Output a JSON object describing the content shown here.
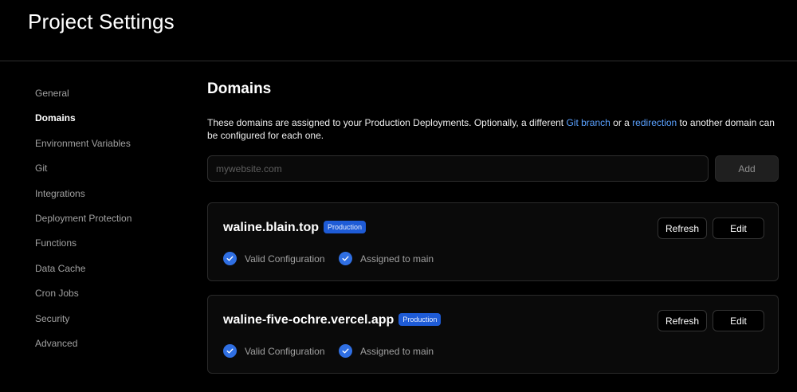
{
  "header": {
    "title": "Project Settings"
  },
  "sidebar": {
    "items": [
      {
        "label": "General",
        "active": false
      },
      {
        "label": "Domains",
        "active": true
      },
      {
        "label": "Environment Variables",
        "active": false
      },
      {
        "label": "Git",
        "active": false
      },
      {
        "label": "Integrations",
        "active": false
      },
      {
        "label": "Deployment Protection",
        "active": false
      },
      {
        "label": "Functions",
        "active": false
      },
      {
        "label": "Data Cache",
        "active": false
      },
      {
        "label": "Cron Jobs",
        "active": false
      },
      {
        "label": "Security",
        "active": false
      },
      {
        "label": "Advanced",
        "active": false
      }
    ]
  },
  "main": {
    "title": "Domains",
    "description": {
      "part1": "These domains are assigned to your Production Deployments. Optionally, a different ",
      "link1": "Git branch",
      "part2": " or a ",
      "link2": "redirection",
      "part3": " to another domain can be configured for each one."
    },
    "input": {
      "placeholder": "mywebsite.com",
      "value": ""
    },
    "add_label": "Add",
    "domains": [
      {
        "name": "waline.blain.top",
        "badge": "Production",
        "refresh_label": "Refresh",
        "edit_label": "Edit",
        "status1": "Valid Configuration",
        "status2": "Assigned to main"
      },
      {
        "name": "waline-five-ochre.vercel.app",
        "badge": "Production",
        "refresh_label": "Refresh",
        "edit_label": "Edit",
        "status1": "Valid Configuration",
        "status2": "Assigned to main"
      }
    ]
  },
  "colors": {
    "background": "#000000",
    "accent_link": "#5aa1ff",
    "badge": "#1e5bd6",
    "check": "#2f6fe3"
  }
}
